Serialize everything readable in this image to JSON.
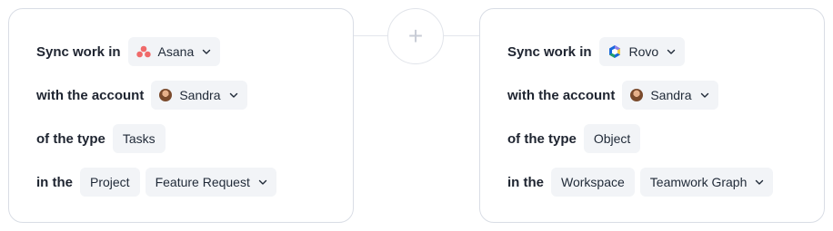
{
  "left": {
    "app_label": "Sync work in",
    "app_value": "Asana",
    "app_icon": "asana-logo-icon",
    "account_label": "with the account",
    "account_value": "Sandra",
    "type_label": "of the type",
    "type_value": "Tasks",
    "container_label": "in the",
    "container_type": "Project",
    "container_value": "Feature Request"
  },
  "right": {
    "app_label": "Sync work in",
    "app_value": "Rovo",
    "app_icon": "rovo-logo-icon",
    "account_label": "with the account",
    "account_value": "Sandra",
    "type_label": "of the type",
    "type_value": "Object",
    "container_label": "in the",
    "container_type": "Workspace",
    "container_value": "Teamwork Graph"
  },
  "connector": {
    "icon": "plus-icon",
    "symbol": "+"
  },
  "colors": {
    "asana": "#f06a6a",
    "rovo_blue": "#1868db",
    "rovo_green": "#22a06b",
    "rovo_yellow": "#f5cd47",
    "rovo_purple": "#8f7ee7",
    "chip_bg": "#f2f4f7",
    "border": "#d9dde5"
  }
}
